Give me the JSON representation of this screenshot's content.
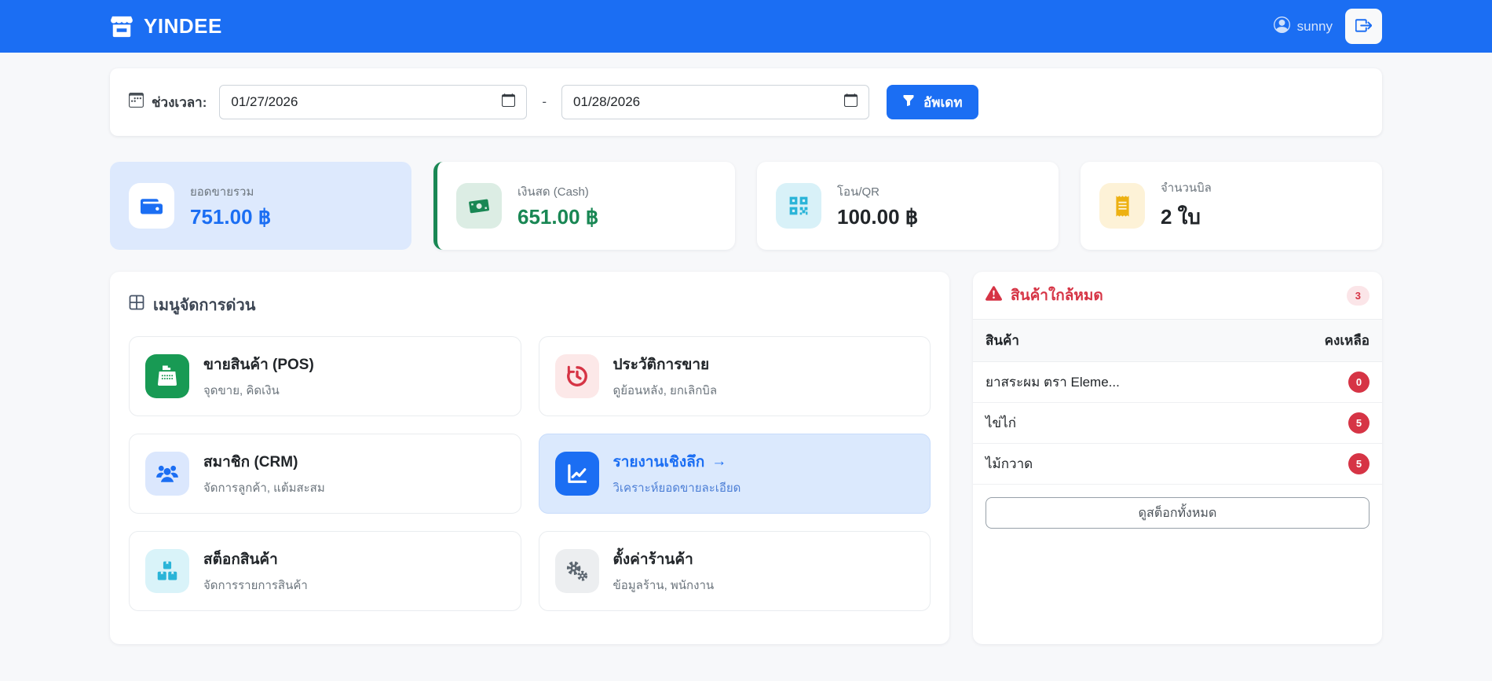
{
  "navbar": {
    "brand": "YINDEE",
    "username": "sunny"
  },
  "filter": {
    "label": "ช่วงเวลา:",
    "start_date": "01/27/2026",
    "separator": "-",
    "end_date": "01/28/2026",
    "update_button": "อัพเดท"
  },
  "stats": [
    {
      "label": "ยอดขายรวม",
      "value": "751.00 ฿"
    },
    {
      "label": "เงินสด (Cash)",
      "value": "651.00 ฿"
    },
    {
      "label": "โอน/QR",
      "value": "100.00 ฿"
    },
    {
      "label": "จำนวนบิล",
      "value": "2 ใบ"
    }
  ],
  "quick_menu": {
    "title": "เมนูจัดการด่วน",
    "items": [
      {
        "title": "ขายสินค้า (POS)",
        "subtitle": "จุดขาย, คิดเงิน"
      },
      {
        "title": "ประวัติการขาย",
        "subtitle": "ดูย้อนหลัง, ยกเลิกบิล"
      },
      {
        "title": "สมาชิก (CRM)",
        "subtitle": "จัดการลูกค้า, แต้มสะสม"
      },
      {
        "title": "รายงานเชิงลึก",
        "arrow": "→",
        "subtitle": "วิเคราะห์ยอดขายละเอียด"
      },
      {
        "title": "สต็อกสินค้า",
        "subtitle": "จัดการรายการสินค้า"
      },
      {
        "title": "ตั้งค่าร้านค้า",
        "subtitle": "ข้อมูลร้าน, พนักงาน"
      }
    ]
  },
  "low_stock": {
    "title": "สินค้าใกล้หมด",
    "badge": "3",
    "columns": {
      "product": "สินค้า",
      "remaining": "คงเหลือ"
    },
    "rows": [
      {
        "name": "ยาสระผม ตรา Eleme...",
        "qty": "0"
      },
      {
        "name": "ไข่ไก่",
        "qty": "5"
      },
      {
        "name": "ไม้กวาด",
        "qty": "5"
      }
    ],
    "view_all_button": "ดูสต็อกทั้งหมด"
  },
  "icons": {
    "brand": "storefront",
    "user": "person-circle",
    "logout": "box-arrow-right",
    "filter_label": "calendar-dots",
    "date_picker": "calendar",
    "update": "funnel",
    "stat_sales": "wallet",
    "stat_cash": "banknote",
    "stat_qr": "qr-code",
    "stat_bills": "receipt",
    "menu_header": "grid",
    "menu_pos": "cash-register",
    "menu_history": "clock-history",
    "menu_crm": "people",
    "menu_reports": "chart-line",
    "menu_stock": "boxes",
    "menu_settings": "gears",
    "low_stock_alert": "warning-triangle"
  },
  "colors": {
    "primary": "#1b6ef3",
    "success": "#198754",
    "info": "#2ab4d8",
    "warning": "#edb112",
    "danger": "#d63445",
    "sales_card_bg": "#dde9fd",
    "active_menu_bg": "#dbe9fd",
    "page_bg": "#f7f8fa"
  }
}
